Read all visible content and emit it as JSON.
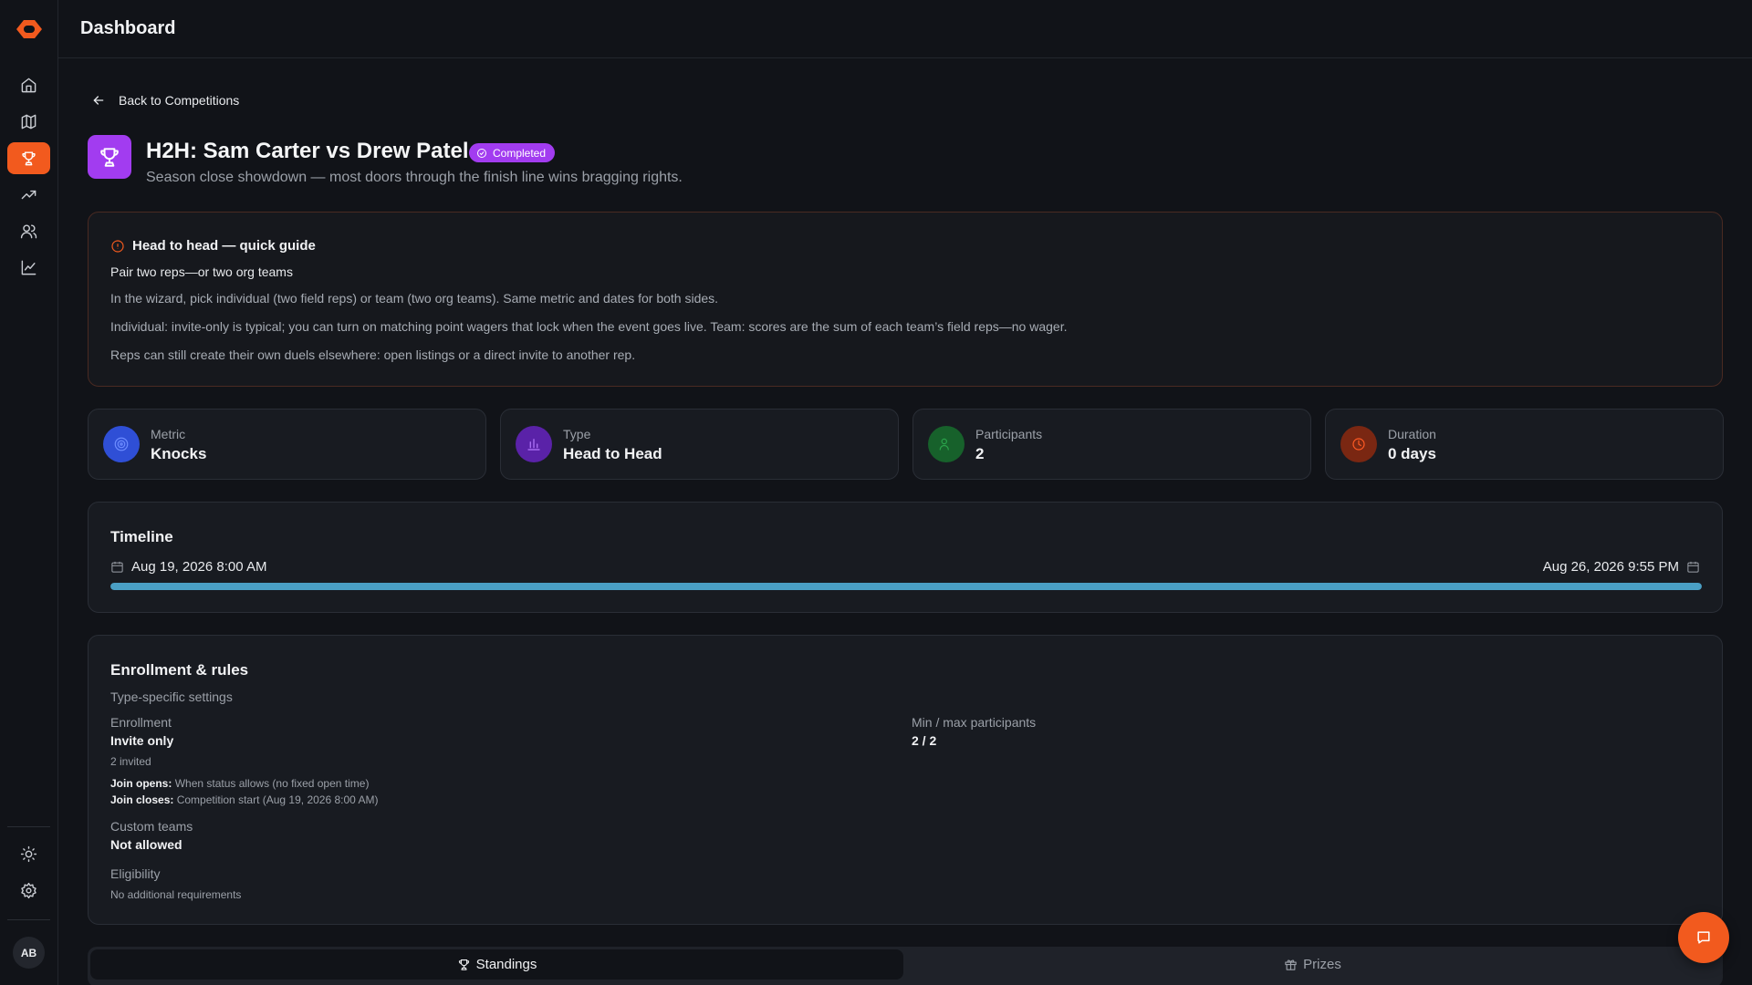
{
  "header": {
    "title": "Dashboard"
  },
  "sidebar": {
    "items": [
      {
        "icon": "home-icon"
      },
      {
        "icon": "map-icon"
      },
      {
        "icon": "trophy-icon",
        "active": true
      },
      {
        "icon": "trending-up-icon"
      },
      {
        "icon": "users-icon"
      },
      {
        "icon": "line-chart-icon"
      }
    ],
    "bottom_items": [
      {
        "icon": "sun-icon"
      },
      {
        "icon": "gear-icon"
      }
    ],
    "avatar_initials": "AB"
  },
  "back_link": {
    "label": "Back to Competitions"
  },
  "competition": {
    "title": "H2H: Sam Carter vs Drew Patel",
    "status": "Completed",
    "subtitle": "Season close showdown — most doors through the finish line wins bragging rights."
  },
  "guide": {
    "title": "Head to head — quick guide",
    "subtitle": "Pair two reps—or two org teams",
    "lines": [
      "In the wizard, pick individual (two field reps) or team (two org teams). Same metric and dates for both sides.",
      "Individual: invite-only is typical; you can turn on matching point wagers that lock when the event goes live. Team: scores are the sum of each team’s field reps—no wager.",
      "Reps can still create their own duels elsewhere: open listings or a direct invite to another rep."
    ]
  },
  "stats": [
    {
      "label": "Metric",
      "value": "Knocks",
      "icon": "target-icon",
      "color": "#2f4fd6"
    },
    {
      "label": "Type",
      "value": "Head to Head",
      "icon": "bar-chart-icon",
      "color": "#7a2fd6"
    },
    {
      "label": "Participants",
      "value": "2",
      "icon": "users-icon",
      "color": "#1f8a3a"
    },
    {
      "label": "Duration",
      "value": "0 days",
      "icon": "clock-icon",
      "color": "#e0491c"
    }
  ],
  "timeline": {
    "title": "Timeline",
    "start": "Aug 19, 2026 8:00 AM",
    "end": "Aug 26, 2026 9:55 PM",
    "progress": 1.0
  },
  "rules": {
    "title": "Enrollment & rules",
    "subtitle": "Type-specific settings",
    "enrollment_label": "Enrollment",
    "enrollment_value": "Invite only",
    "invited": "2 invited",
    "join_opens_label": "Join opens:",
    "join_opens_value": "When status allows (no fixed open time)",
    "join_closes_label": "Join closes:",
    "join_closes_value": "Competition start (Aug 19, 2026 8:00 AM)",
    "custom_teams_label": "Custom teams",
    "custom_teams_value": "Not allowed",
    "eligibility_label": "Eligibility",
    "eligibility_value": "No additional requirements",
    "minmax_label": "Min / max participants",
    "minmax_value": "2 / 2"
  },
  "tabs": [
    {
      "label": "Standings",
      "icon": "trophy-icon",
      "active": true
    },
    {
      "label": "Prizes",
      "icon": "gift-icon",
      "active": false
    }
  ],
  "colors": {
    "accent": "#f25a1e",
    "badge": "#a23cf0",
    "timeline": "#4a9fc4"
  }
}
